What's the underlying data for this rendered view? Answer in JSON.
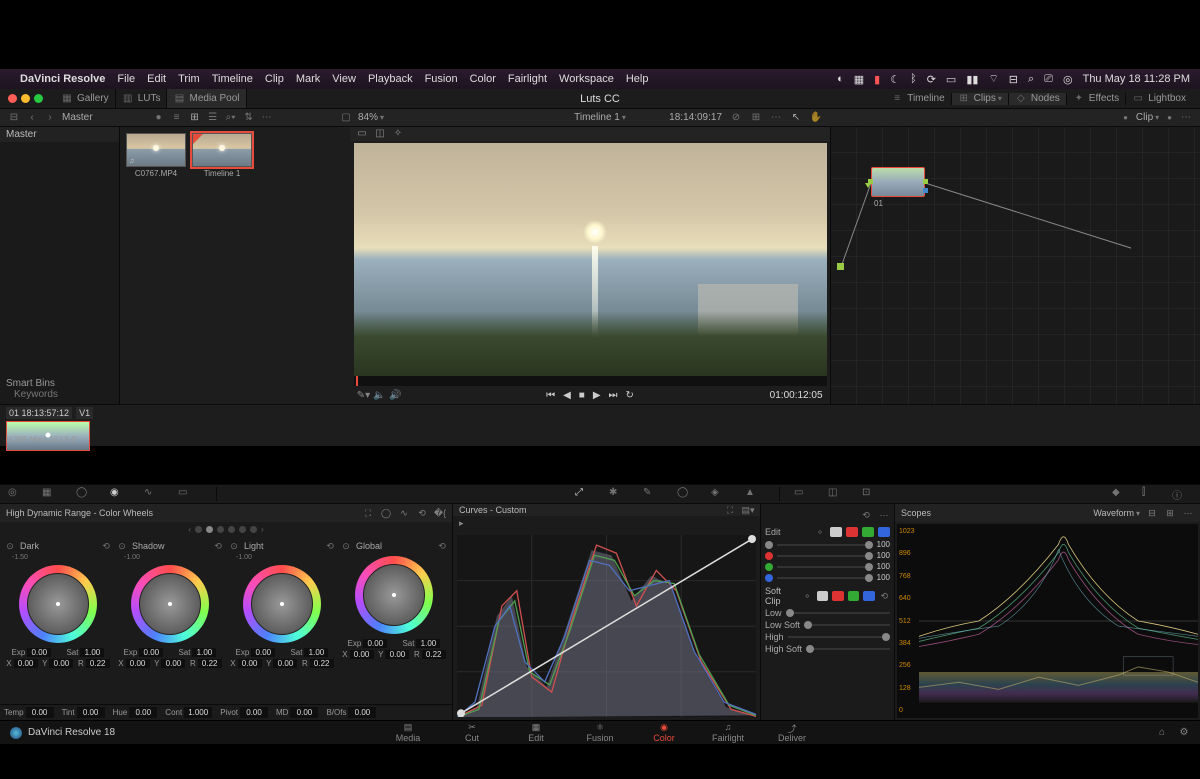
{
  "mac_menu": {
    "app": "DaVinci Resolve",
    "items": [
      "File",
      "Edit",
      "Trim",
      "Timeline",
      "Clip",
      "Mark",
      "View",
      "Playback",
      "Fusion",
      "Color",
      "Fairlight",
      "Workspace",
      "Help"
    ],
    "clock": "Thu May 18  11:28 PM"
  },
  "toolbar": {
    "gallery": "Gallery",
    "luts": "LUTs",
    "mediapool": "Media Pool",
    "title": "Luts CC",
    "timeline": "Timeline",
    "clips": "Clips",
    "nodes": "Nodes",
    "effects": "Effects",
    "lightbox": "Lightbox"
  },
  "sub": {
    "master": "Master",
    "zoom": "84%",
    "timeline": "Timeline 1",
    "timecode": "18:14:09:17",
    "clip": "Clip"
  },
  "media": {
    "header": "Master",
    "smartbins": "Smart Bins",
    "keywords": "Keywords"
  },
  "clips": [
    {
      "name": "C0767.MP4"
    },
    {
      "name": "Timeline 1"
    }
  ],
  "viewer": {
    "timecode": "01:00:12:05"
  },
  "node": {
    "label": "01"
  },
  "strip": {
    "meta": "H.265 Main 10 L5.0",
    "tc": "01   18:13:57:12",
    "track": "V1"
  },
  "wheels_panel": {
    "title": "High Dynamic Range - Color Wheels",
    "cols": [
      {
        "name": "Dark",
        "sub": "-1.50",
        "exp": "0.00",
        "sat": "1.00",
        "x": "0.00",
        "y": "0.00",
        "r": "0.22"
      },
      {
        "name": "Shadow",
        "sub": "-1.00",
        "exp": "0.00",
        "sat": "1.00",
        "x": "0.00",
        "y": "0.00",
        "r": "0.22"
      },
      {
        "name": "Light",
        "sub": "-1.00",
        "exp": "0.00",
        "sat": "1.00",
        "x": "0.00",
        "y": "0.00",
        "r": "0.22"
      },
      {
        "name": "Global",
        "sub": "",
        "exp": "0.00",
        "sat": "1.00",
        "x": "0.00",
        "y": "0.00",
        "r": "0.22"
      }
    ],
    "globals": {
      "temp": "0.00",
      "tint": "0.00",
      "hue": "0.00",
      "cont": "1.000",
      "pivot": "0.00",
      "md": "0.00",
      "bofs": "0.00"
    }
  },
  "curves": {
    "title": "Curves - Custom"
  },
  "edit_channels": {
    "label": "Edit",
    "all": "100",
    "r": "100",
    "g": "100",
    "b": "100"
  },
  "softclip": {
    "label": "Soft Clip",
    "low": "Low",
    "lowsoft": "Low Soft",
    "high": "High",
    "highsoft": "High Soft"
  },
  "scopes": {
    "title": "Scopes",
    "mode": "Waveform",
    "ticks": [
      "1023",
      "896",
      "768",
      "640",
      "512",
      "384",
      "256",
      "128",
      "0"
    ]
  },
  "pages": [
    "Media",
    "Cut",
    "Edit",
    "Fusion",
    "Color",
    "Fairlight",
    "Deliver"
  ],
  "brand": "DaVinci Resolve 18"
}
